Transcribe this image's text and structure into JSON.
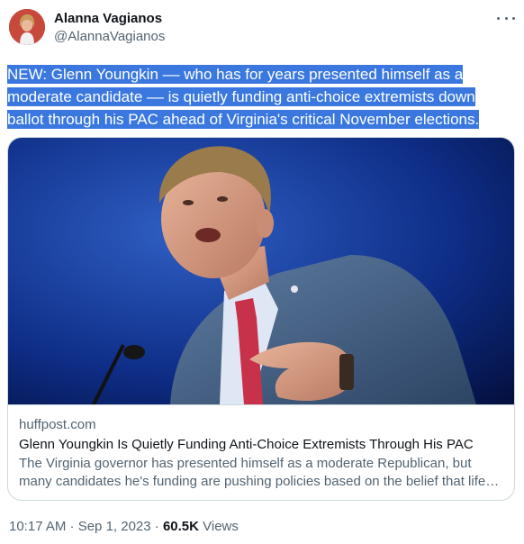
{
  "author": {
    "display_name": "Alanna Vagianos",
    "handle": "@AlannaVagianos"
  },
  "tweet": {
    "lines": [
      "NEW: Glenn Youngkin –– who has for years presented himself as a",
      "moderate candidate –– is quietly funding anti-choice extremists down",
      "ballot through his PAC ahead of Virginia's critical November elections."
    ],
    "highlight_color": "#3a78e0"
  },
  "card": {
    "domain": "huffpost.com",
    "title": "Glenn Youngkin Is Quietly Funding Anti-Choice Extremists Through His PAC",
    "description": "The Virginia governor has presented himself as a moderate Republican, but many candidates he's funding are pushing policies based on the belief that life begins at conception."
  },
  "meta": {
    "timestamp": "10:17 AM · Sep 1, 2023 · ",
    "views_count": "60.5K",
    "views_label": " Views"
  },
  "colors": {
    "text_primary": "#0f1419",
    "text_secondary": "#536471",
    "border": "#cfd9de"
  }
}
